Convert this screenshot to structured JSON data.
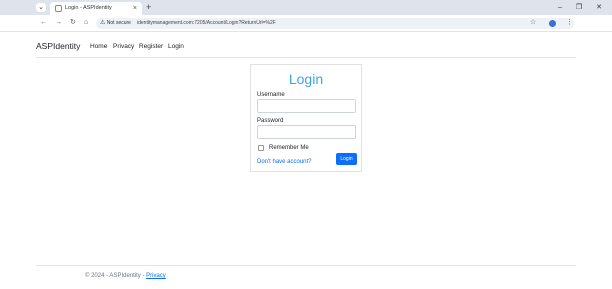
{
  "browser": {
    "tab_title": "Login - ASPIdentity",
    "tab_close": "×",
    "new_tab": "+",
    "window_controls": {
      "minimize": "–",
      "restore": "❐",
      "close": "✕"
    },
    "not_secure": "Not secure",
    "url": "identitymanagement.com:7205/Account/Login?ReturnUrl=%2F"
  },
  "site_nav": {
    "brand": "ASPIdentity",
    "links": [
      "Home",
      "Privacy",
      "Register",
      "Login"
    ]
  },
  "login": {
    "title": "Login",
    "username_label": "Username",
    "username_value": "",
    "password_label": "Password",
    "password_value": "",
    "remember_label": "Remember Me",
    "register_link": "Don't have account?",
    "submit_label": "Login"
  },
  "footer": {
    "copyright": "© 2024 - ASPIdentity -",
    "privacy_link": "Privacy"
  },
  "colors": {
    "accent": "#3aa7df",
    "primary": "#0d6efd"
  }
}
